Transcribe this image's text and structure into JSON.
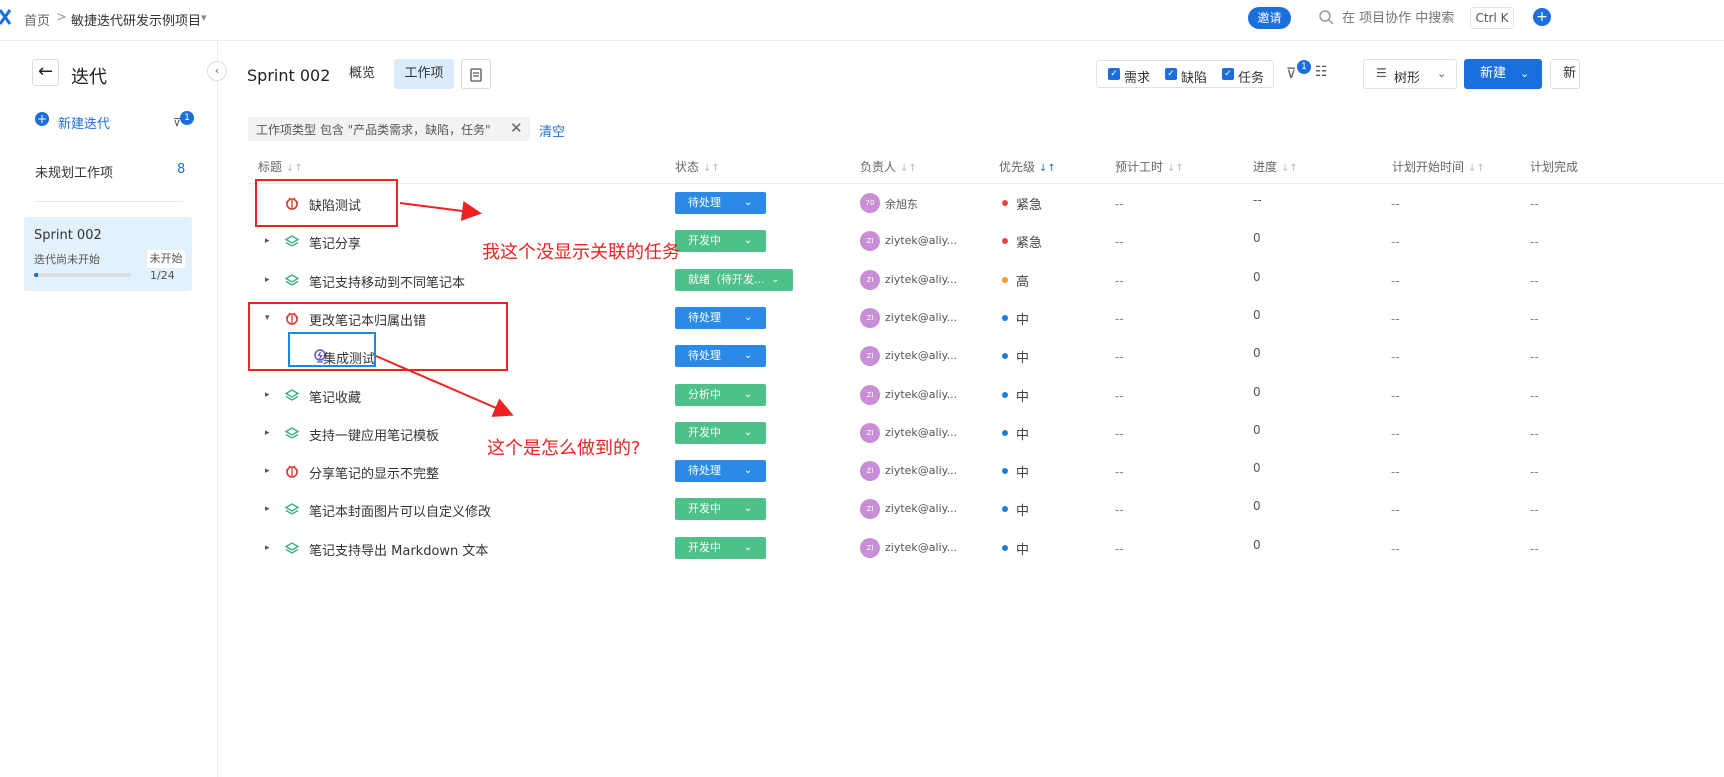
{
  "topbar": {
    "breadcrumb_home": "首页",
    "breadcrumb_sep": ">",
    "project_name": "敏捷迭代研发示例项目",
    "invite_label": "邀请",
    "search_placeholder": "在 项目协作 中搜索",
    "shortcut": "Ctrl K"
  },
  "sidebar": {
    "title": "迭代",
    "new_iteration": "新建迭代",
    "filter_count": "1",
    "unplanned_label": "未规划工作项",
    "unplanned_count": "8",
    "sprint": {
      "name": "Sprint 002",
      "sub": "迭代尚未开始",
      "status": "未开始",
      "count": "1/24",
      "progress": 0.04
    }
  },
  "header": {
    "sprint_title": "Sprint 002",
    "tab_overview": "概览",
    "tab_items": "工作项",
    "type_filters": [
      "需求",
      "缺陷",
      "任务"
    ],
    "filter_badge": "1",
    "view_mode": "树形",
    "new_label": "新建",
    "extra_label": "新"
  },
  "filter": {
    "chip_text": "工作项类型 包含 \"产品类需求，缺陷，任务\"",
    "clear_label": "清空"
  },
  "columns": {
    "title": "标题",
    "status": "状态",
    "assignee": "负责人",
    "priority": "优先级",
    "estimate": "预计工时",
    "progress": "进度",
    "start": "计划开始时间",
    "end": "计划完成"
  },
  "rows": [
    {
      "title": "缺陷测试",
      "type": "bug",
      "expand": "",
      "status": "待处理",
      "avatar": "70",
      "assignee": "余旭东",
      "priority": "紧急",
      "pcolor": "#e5473f",
      "est": "--",
      "prog": "--",
      "start": "--",
      "end": "--"
    },
    {
      "title": "笔记分享",
      "type": "story",
      "expand": "▸",
      "status": "开发中",
      "avatar": "ZI",
      "assignee": "ziytek@aliy...",
      "priority": "紧急",
      "pcolor": "#e5473f",
      "est": "--",
      "prog": "0",
      "start": "--",
      "end": "--"
    },
    {
      "title": "笔记支持移动到不同笔记本",
      "type": "story",
      "expand": "▸",
      "status": "就绪（待开发...",
      "avatar": "ZI",
      "assignee": "ziytek@aliy...",
      "priority": "高",
      "pcolor": "#f39c2b",
      "est": "--",
      "prog": "0",
      "start": "--",
      "end": "--"
    },
    {
      "title": "更改笔记本归属出错",
      "type": "bug",
      "expand": "▾",
      "status": "待处理",
      "avatar": "ZI",
      "assignee": "ziytek@aliy...",
      "priority": "中",
      "pcolor": "#1b7fd9",
      "est": "--",
      "prog": "0",
      "start": "--",
      "end": "--"
    },
    {
      "title": "集成测试",
      "type": "task",
      "expand": "",
      "status": "待处理",
      "avatar": "ZI",
      "assignee": "ziytek@aliy...",
      "priority": "中",
      "pcolor": "#1b7fd9",
      "est": "--",
      "prog": "0",
      "start": "--",
      "end": "--"
    },
    {
      "title": "笔记收藏",
      "type": "story",
      "expand": "▸",
      "status": "分析中",
      "avatar": "ZI",
      "assignee": "ziytek@aliy...",
      "priority": "中",
      "pcolor": "#1b7fd9",
      "est": "--",
      "prog": "0",
      "start": "--",
      "end": "--"
    },
    {
      "title": "支持一键应用笔记模板",
      "type": "story",
      "expand": "▸",
      "status": "开发中",
      "avatar": "ZI",
      "assignee": "ziytek@aliy...",
      "priority": "中",
      "pcolor": "#1b7fd9",
      "est": "--",
      "prog": "0",
      "start": "--",
      "end": "--"
    },
    {
      "title": "分享笔记的显示不完整",
      "type": "bug",
      "expand": "▸",
      "status": "待处理",
      "avatar": "ZI",
      "assignee": "ziytek@aliy...",
      "priority": "中",
      "pcolor": "#1b7fd9",
      "est": "--",
      "prog": "0",
      "start": "--",
      "end": "--"
    },
    {
      "title": "笔记本封面图片可以自定义修改",
      "type": "story",
      "expand": "▸",
      "status": "开发中",
      "avatar": "ZI",
      "assignee": "ziytek@aliy...",
      "priority": "中",
      "pcolor": "#1b7fd9",
      "est": "--",
      "prog": "0",
      "start": "--",
      "end": "--"
    },
    {
      "title": "笔记支持导出 Markdown 文本",
      "type": "story",
      "expand": "▸",
      "status": "开发中",
      "avatar": "ZI",
      "assignee": "ziytek@aliy...",
      "priority": "中",
      "pcolor": "#1b7fd9",
      "est": "--",
      "prog": "0",
      "start": "--",
      "end": "--"
    }
  ],
  "annotations": {
    "note1": "我这个没显示关联的任务",
    "note2": "这个是怎么做到的?"
  },
  "colors": {
    "accent": "#1b6fdc",
    "status_blue": "#2a8ae6",
    "status_green": "#4ec08a",
    "annotation_red": "#ee2222"
  }
}
